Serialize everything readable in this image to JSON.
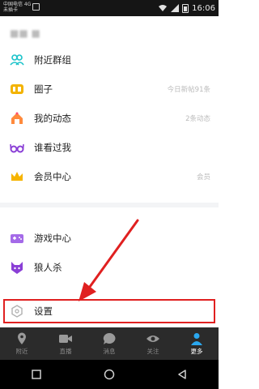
{
  "status_bar": {
    "carrier_line1": "中国电信 4G",
    "carrier_line2": "未插卡",
    "time": "16:06"
  },
  "menu": {
    "items": [
      {
        "label": "附近群组",
        "hint": "",
        "icon": "group-icon"
      },
      {
        "label": "圈子",
        "hint": "今日新帖91条",
        "icon": "circle-chat-icon"
      },
      {
        "label": "我的动态",
        "hint": "2条动态",
        "icon": "moments-icon"
      },
      {
        "label": "谁看过我",
        "hint": "",
        "icon": "glasses-icon"
      },
      {
        "label": "会员中心",
        "hint": "会员",
        "icon": "crown-icon"
      },
      {
        "label": "游戏中心",
        "hint": "",
        "icon": "game-icon"
      },
      {
        "label": "狼人杀",
        "hint": "",
        "icon": "wolf-icon"
      }
    ],
    "settings_label": "设置"
  },
  "tabs": [
    {
      "label": "附近",
      "icon": "location-pin-icon",
      "active": false
    },
    {
      "label": "直播",
      "icon": "video-camera-icon",
      "active": false
    },
    {
      "label": "消息",
      "icon": "chat-bubble-icon",
      "active": false
    },
    {
      "label": "关注",
      "icon": "eye-icon",
      "active": false
    },
    {
      "label": "更多",
      "icon": "person-icon",
      "active": true
    }
  ],
  "colors": {
    "accent": "#2aa8f0",
    "highlight_red": "#e02020",
    "tab_bar": "#2b2b2b"
  }
}
